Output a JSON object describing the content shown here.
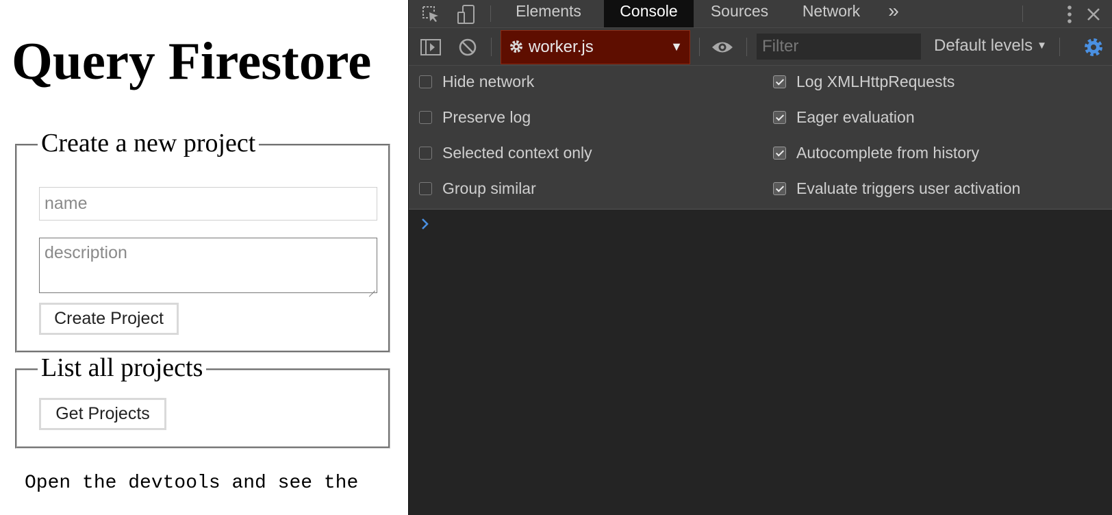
{
  "page": {
    "title": "Query Firestore",
    "create_section": {
      "legend": "Create a new project",
      "name_placeholder": "name",
      "description_placeholder": "description",
      "button_label": "Create Project"
    },
    "list_section": {
      "legend": "List all projects",
      "button_label": "Get Projects"
    },
    "footer_text": "Open the devtools and see the"
  },
  "devtools": {
    "tabs": [
      {
        "label": "Elements",
        "active": false
      },
      {
        "label": "Console",
        "active": true
      },
      {
        "label": "Sources",
        "active": false
      },
      {
        "label": "Network",
        "active": false
      }
    ],
    "more_tabs_glyph": "»",
    "icons": [
      "inspect-element-icon",
      "device-toggle-icon",
      "kebab-menu-icon",
      "close-icon",
      "sidebar-toggle-icon",
      "clear-console-icon",
      "eye-icon",
      "settings-gear-icon",
      "prompt-chevron-icon"
    ],
    "context": {
      "label": "worker.js",
      "icon": "gear-icon",
      "background_color": "#5e0e00"
    },
    "filter_placeholder": "Filter",
    "levels_label": "Default levels",
    "accent_color": "#4a90e2",
    "settings": {
      "left": [
        {
          "label": "Hide network",
          "checked": false
        },
        {
          "label": "Preserve log",
          "checked": false
        },
        {
          "label": "Selected context only",
          "checked": false
        },
        {
          "label": "Group similar",
          "checked": false
        }
      ],
      "right": [
        {
          "label": "Log XMLHttpRequests",
          "checked": true
        },
        {
          "label": "Eager evaluation",
          "checked": true
        },
        {
          "label": "Autocomplete from history",
          "checked": true
        },
        {
          "label": "Evaluate triggers user activation",
          "checked": true
        }
      ]
    }
  }
}
